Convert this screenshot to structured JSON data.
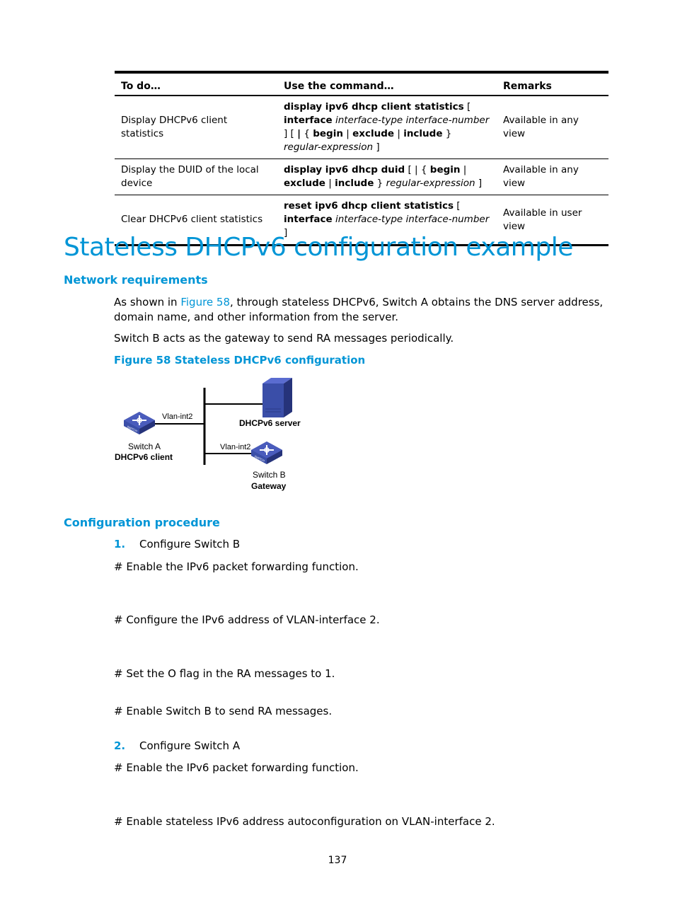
{
  "table": {
    "headers": [
      "To do…",
      "Use the command…",
      "Remarks"
    ],
    "rows": [
      {
        "todo": "Display DHCPv6 client statistics",
        "command_parts": [
          {
            "t": "display ipv6 dhcp client statistics",
            "s": "b"
          },
          {
            "t": " [ ",
            "s": ""
          },
          {
            "t": "interface",
            "s": "b"
          },
          {
            "t": " ",
            "s": ""
          },
          {
            "t": "interface-type interface-number",
            "s": "i"
          },
          {
            "t": " ] [ ",
            "s": ""
          },
          {
            "t": "|",
            "s": "b"
          },
          {
            "t": " { ",
            "s": ""
          },
          {
            "t": "begin",
            "s": "b"
          },
          {
            "t": " | ",
            "s": ""
          },
          {
            "t": "exclude",
            "s": "b"
          },
          {
            "t": " | ",
            "s": ""
          },
          {
            "t": "include",
            "s": "b"
          },
          {
            "t": " } ",
            "s": ""
          },
          {
            "t": "regular-expression",
            "s": "i"
          },
          {
            "t": " ]",
            "s": ""
          }
        ],
        "remarks": "Available in any view"
      },
      {
        "todo": "Display the DUID of the local device",
        "command_parts": [
          {
            "t": "display ipv6 dhcp duid",
            "s": "b"
          },
          {
            "t": " [ | { ",
            "s": ""
          },
          {
            "t": "begin",
            "s": "b"
          },
          {
            "t": " | ",
            "s": ""
          },
          {
            "t": "exclude",
            "s": "b"
          },
          {
            "t": " | ",
            "s": ""
          },
          {
            "t": "include",
            "s": "b"
          },
          {
            "t": " } ",
            "s": ""
          },
          {
            "t": "regular-expression",
            "s": "i"
          },
          {
            "t": " ]",
            "s": ""
          }
        ],
        "remarks": "Available in any view"
      },
      {
        "todo": "Clear DHCPv6 client statistics",
        "command_parts": [
          {
            "t": "reset ipv6 dhcp client statistics",
            "s": "b"
          },
          {
            "t": " [ ",
            "s": ""
          },
          {
            "t": "interface",
            "s": "b"
          },
          {
            "t": " ",
            "s": ""
          },
          {
            "t": "interface-type interface-number",
            "s": "i"
          },
          {
            "t": " ]",
            "s": ""
          }
        ],
        "remarks": "Available in user view"
      }
    ]
  },
  "section": {
    "title": "Stateless DHCPv6 configuration example",
    "network_requirements": {
      "heading": "Network requirements",
      "para1_prefix": "As shown in ",
      "para1_link": "Figure 58",
      "para1_suffix": ", through stateless DHCPv6, Switch A obtains the DNS server address, domain name, and other information from the server.",
      "para2": "Switch B acts as the gateway to send RA messages periodically.",
      "figure_caption": "Figure 58 Stateless DHCPv6 configuration"
    },
    "diagram": {
      "switch_a_iface": "Vlan-int2",
      "switch_a_name": "Switch A",
      "switch_a_role": "DHCPv6 client",
      "server_label": "DHCPv6 server",
      "switch_b_iface": "Vlan-int2",
      "switch_b_name": "Switch B",
      "switch_b_role": "Gateway",
      "colors": {
        "device_blue": "#3a4ea8",
        "device_dark": "#26337a",
        "line": "#000000"
      }
    },
    "procedure": {
      "heading": "Configuration procedure",
      "steps": [
        {
          "num": "1.",
          "label": "Configure Switch B"
        },
        {
          "num": "2.",
          "label": "Configure Switch A"
        }
      ],
      "comments": [
        "# Enable the IPv6 packet forwarding function.",
        "# Configure the IPv6 address of VLAN-interface 2.",
        "# Set the O flag in the RA messages to 1.",
        "# Enable Switch B to send RA messages.",
        "# Enable the IPv6 packet forwarding function.",
        "# Enable stateless IPv6 address autoconfiguration on VLAN-interface 2."
      ]
    }
  },
  "page_number": "137",
  "colors": {
    "accent": "#0095d6",
    "text": "#000000"
  }
}
